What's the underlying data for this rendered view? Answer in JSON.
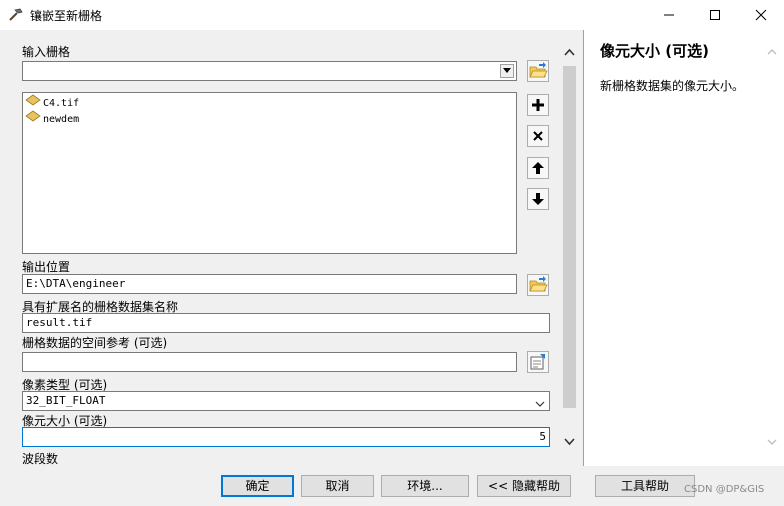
{
  "window": {
    "title": "镶嵌至新栅格",
    "icon": "hammer-icon",
    "controls": [
      "minimize-icon",
      "maximize-icon",
      "close-icon"
    ]
  },
  "form": {
    "input_rasters": {
      "label": "输入栅格",
      "value": "",
      "list": [
        "C4.tif",
        "newdem"
      ]
    },
    "output_location": {
      "label": "输出位置",
      "value": "E:\\DTA\\engineer"
    },
    "dataset_name": {
      "label": "具有扩展名的栅格数据集名称",
      "value": "result.tif"
    },
    "spatial_reference": {
      "label": "栅格数据的空间参考 (可选)",
      "value": ""
    },
    "pixel_type": {
      "label": "像素类型 (可选)",
      "value": "32_BIT_FLOAT"
    },
    "cellsize": {
      "label": "像元大小 (可选)",
      "value": "5"
    },
    "bands": {
      "label": "波段数"
    }
  },
  "help": {
    "title": "像元大小 (可选)",
    "text": "新栅格数据集的像元大小。"
  },
  "buttons": {
    "ok": "确定",
    "cancel": "取消",
    "environments": "环境...",
    "hide_help": "<< 隐藏帮助",
    "tool_help": "工具帮助"
  },
  "watermark": "CSDN @DP&GIS",
  "colors": {
    "accent": "#0078d7",
    "window_bg": "#f0f0f0",
    "field_border": "#7a7a7a"
  }
}
